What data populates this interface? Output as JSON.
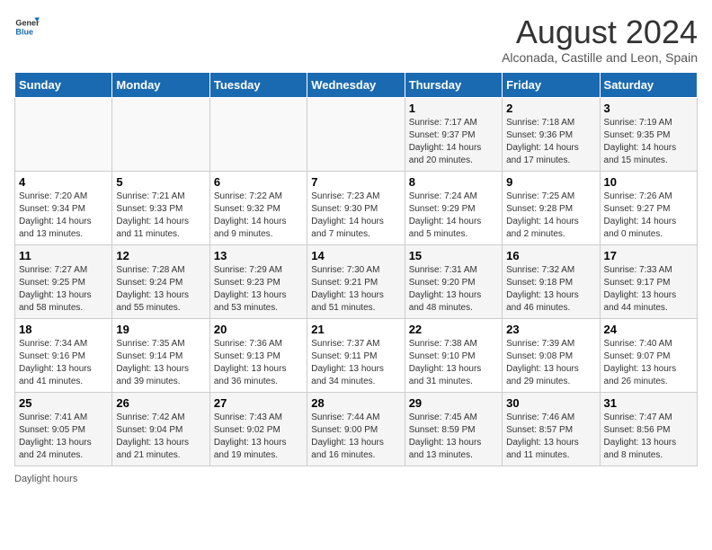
{
  "header": {
    "logo_general": "General",
    "logo_blue": "Blue",
    "month_year": "August 2024",
    "location": "Alconada, Castille and Leon, Spain"
  },
  "calendar": {
    "days_of_week": [
      "Sunday",
      "Monday",
      "Tuesday",
      "Wednesday",
      "Thursday",
      "Friday",
      "Saturday"
    ],
    "weeks": [
      [
        {
          "day": "",
          "info": ""
        },
        {
          "day": "",
          "info": ""
        },
        {
          "day": "",
          "info": ""
        },
        {
          "day": "",
          "info": ""
        },
        {
          "day": "1",
          "info": "Sunrise: 7:17 AM\nSunset: 9:37 PM\nDaylight: 14 hours and 20 minutes."
        },
        {
          "day": "2",
          "info": "Sunrise: 7:18 AM\nSunset: 9:36 PM\nDaylight: 14 hours and 17 minutes."
        },
        {
          "day": "3",
          "info": "Sunrise: 7:19 AM\nSunset: 9:35 PM\nDaylight: 14 hours and 15 minutes."
        }
      ],
      [
        {
          "day": "4",
          "info": "Sunrise: 7:20 AM\nSunset: 9:34 PM\nDaylight: 14 hours and 13 minutes."
        },
        {
          "day": "5",
          "info": "Sunrise: 7:21 AM\nSunset: 9:33 PM\nDaylight: 14 hours and 11 minutes."
        },
        {
          "day": "6",
          "info": "Sunrise: 7:22 AM\nSunset: 9:32 PM\nDaylight: 14 hours and 9 minutes."
        },
        {
          "day": "7",
          "info": "Sunrise: 7:23 AM\nSunset: 9:30 PM\nDaylight: 14 hours and 7 minutes."
        },
        {
          "day": "8",
          "info": "Sunrise: 7:24 AM\nSunset: 9:29 PM\nDaylight: 14 hours and 5 minutes."
        },
        {
          "day": "9",
          "info": "Sunrise: 7:25 AM\nSunset: 9:28 PM\nDaylight: 14 hours and 2 minutes."
        },
        {
          "day": "10",
          "info": "Sunrise: 7:26 AM\nSunset: 9:27 PM\nDaylight: 14 hours and 0 minutes."
        }
      ],
      [
        {
          "day": "11",
          "info": "Sunrise: 7:27 AM\nSunset: 9:25 PM\nDaylight: 13 hours and 58 minutes."
        },
        {
          "day": "12",
          "info": "Sunrise: 7:28 AM\nSunset: 9:24 PM\nDaylight: 13 hours and 55 minutes."
        },
        {
          "day": "13",
          "info": "Sunrise: 7:29 AM\nSunset: 9:23 PM\nDaylight: 13 hours and 53 minutes."
        },
        {
          "day": "14",
          "info": "Sunrise: 7:30 AM\nSunset: 9:21 PM\nDaylight: 13 hours and 51 minutes."
        },
        {
          "day": "15",
          "info": "Sunrise: 7:31 AM\nSunset: 9:20 PM\nDaylight: 13 hours and 48 minutes."
        },
        {
          "day": "16",
          "info": "Sunrise: 7:32 AM\nSunset: 9:18 PM\nDaylight: 13 hours and 46 minutes."
        },
        {
          "day": "17",
          "info": "Sunrise: 7:33 AM\nSunset: 9:17 PM\nDaylight: 13 hours and 44 minutes."
        }
      ],
      [
        {
          "day": "18",
          "info": "Sunrise: 7:34 AM\nSunset: 9:16 PM\nDaylight: 13 hours and 41 minutes."
        },
        {
          "day": "19",
          "info": "Sunrise: 7:35 AM\nSunset: 9:14 PM\nDaylight: 13 hours and 39 minutes."
        },
        {
          "day": "20",
          "info": "Sunrise: 7:36 AM\nSunset: 9:13 PM\nDaylight: 13 hours and 36 minutes."
        },
        {
          "day": "21",
          "info": "Sunrise: 7:37 AM\nSunset: 9:11 PM\nDaylight: 13 hours and 34 minutes."
        },
        {
          "day": "22",
          "info": "Sunrise: 7:38 AM\nSunset: 9:10 PM\nDaylight: 13 hours and 31 minutes."
        },
        {
          "day": "23",
          "info": "Sunrise: 7:39 AM\nSunset: 9:08 PM\nDaylight: 13 hours and 29 minutes."
        },
        {
          "day": "24",
          "info": "Sunrise: 7:40 AM\nSunset: 9:07 PM\nDaylight: 13 hours and 26 minutes."
        }
      ],
      [
        {
          "day": "25",
          "info": "Sunrise: 7:41 AM\nSunset: 9:05 PM\nDaylight: 13 hours and 24 minutes."
        },
        {
          "day": "26",
          "info": "Sunrise: 7:42 AM\nSunset: 9:04 PM\nDaylight: 13 hours and 21 minutes."
        },
        {
          "day": "27",
          "info": "Sunrise: 7:43 AM\nSunset: 9:02 PM\nDaylight: 13 hours and 19 minutes."
        },
        {
          "day": "28",
          "info": "Sunrise: 7:44 AM\nSunset: 9:00 PM\nDaylight: 13 hours and 16 minutes."
        },
        {
          "day": "29",
          "info": "Sunrise: 7:45 AM\nSunset: 8:59 PM\nDaylight: 13 hours and 13 minutes."
        },
        {
          "day": "30",
          "info": "Sunrise: 7:46 AM\nSunset: 8:57 PM\nDaylight: 13 hours and 11 minutes."
        },
        {
          "day": "31",
          "info": "Sunrise: 7:47 AM\nSunset: 8:56 PM\nDaylight: 13 hours and 8 minutes."
        }
      ]
    ]
  },
  "footer": {
    "note": "Daylight hours"
  }
}
